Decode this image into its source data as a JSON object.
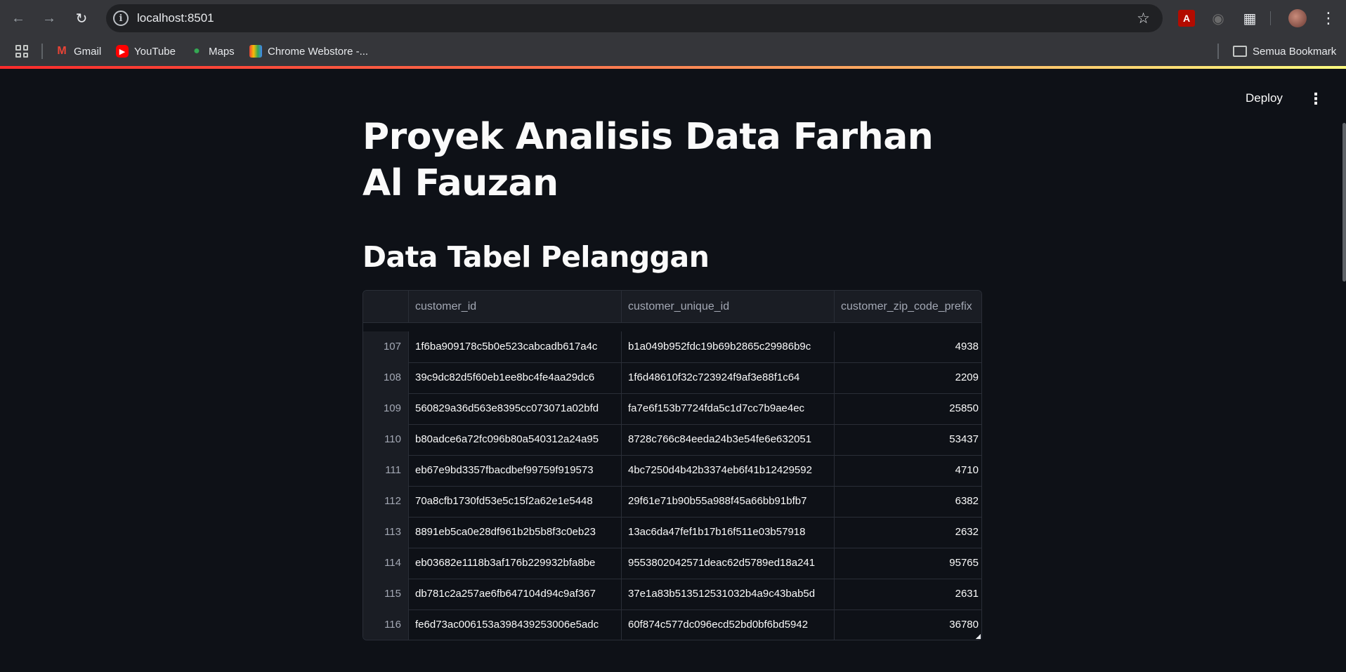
{
  "browser": {
    "url": "localhost:8501",
    "bookmarks": [
      {
        "label": "Gmail",
        "icon": "gmail-icon"
      },
      {
        "label": "YouTube",
        "icon": "youtube-icon"
      },
      {
        "label": "Maps",
        "icon": "maps-icon"
      },
      {
        "label": "Chrome Webstore -...",
        "icon": "webstore-icon"
      }
    ],
    "bookmarks_folder": "Semua Bookmark"
  },
  "app": {
    "deploy_label": "Deploy",
    "title": "Proyek Analisis Data Farhan Al Fauzan",
    "subtitle": "Data Tabel Pelanggan"
  },
  "table": {
    "columns": [
      "customer_id",
      "customer_unique_id",
      "customer_zip_code_prefix"
    ],
    "rows": [
      {
        "index": "107",
        "customer_id": "1f6ba909178c5b0e523cabcadb617a4c",
        "customer_unique_id": "b1a049b952fdc19b69b2865c29986b9c",
        "zip": "4938"
      },
      {
        "index": "108",
        "customer_id": "39c9dc82d5f60eb1ee8bc4fe4aa29dc6",
        "customer_unique_id": "1f6d48610f32c723924f9af3e88f1c64",
        "zip": "2209"
      },
      {
        "index": "109",
        "customer_id": "560829a36d563e8395cc073071a02bfd",
        "customer_unique_id": "fa7e6f153b7724fda5c1d7cc7b9ae4ec",
        "zip": "25850"
      },
      {
        "index": "110",
        "customer_id": "b80adce6a72fc096b80a540312a24a95",
        "customer_unique_id": "8728c766c84eeda24b3e54fe6e632051",
        "zip": "53437"
      },
      {
        "index": "111",
        "customer_id": "eb67e9bd3357fbacdbef99759f919573",
        "customer_unique_id": "4bc7250d4b42b3374eb6f41b12429592",
        "zip": "4710"
      },
      {
        "index": "112",
        "customer_id": "70a8cfb1730fd53e5c15f2a62e1e5448",
        "customer_unique_id": "29f61e71b90b55a988f45a66bb91bfb7",
        "zip": "6382"
      },
      {
        "index": "113",
        "customer_id": "8891eb5ca0e28df961b2b5b8f3c0eb23",
        "customer_unique_id": "13ac6da47fef1b17b16f511e03b57918",
        "zip": "2632"
      },
      {
        "index": "114",
        "customer_id": "eb03682e1118b3af176b229932bfa8be",
        "customer_unique_id": "9553802042571deac62d5789ed18a241",
        "zip": "95765"
      },
      {
        "index": "115",
        "customer_id": "db781c2a257ae6fb647104d94c9af367",
        "customer_unique_id": "37e1a83b513512531032b4a9c43bab5d",
        "zip": "2631"
      },
      {
        "index": "116",
        "customer_id": "fe6d73ac006153a398439253006e5adc",
        "customer_unique_id": "60f874c577dc096ecd52bd0bf6bd5942",
        "zip": "36780"
      }
    ]
  }
}
